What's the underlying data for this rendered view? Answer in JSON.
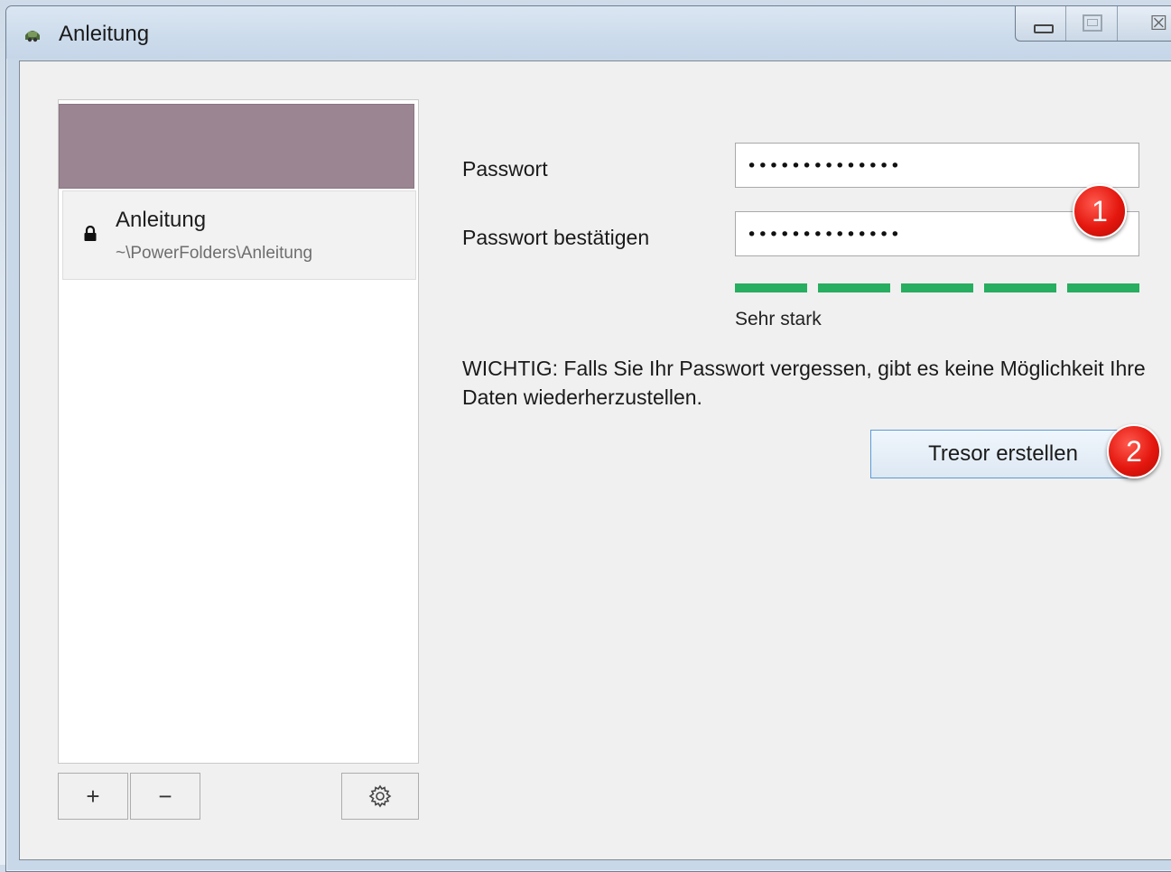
{
  "window": {
    "title": "Anleitung",
    "app_icon": "app-icon",
    "close_glyph": "☒"
  },
  "sidebar": {
    "items": [
      {
        "name": "Anleitung",
        "path": "~\\PowerFolders\\Anleitung",
        "icon": "lock-icon"
      }
    ],
    "add_label": "+",
    "remove_label": "−",
    "settings_icon": "gear-icon"
  },
  "form": {
    "password_label": "Passwort",
    "password_value": "••••••••••••••",
    "confirm_label": "Passwort bestätigen",
    "confirm_value": "••••••••••••••",
    "strength_level": 5,
    "strength_max": 5,
    "strength_text": "Sehr stark",
    "strength_color": "#27ae60",
    "warning_text": "WICHTIG: Falls Sie Ihr Passwort vergessen, gibt es keine Möglichkeit Ihre Daten wiederherzustellen.",
    "create_button": "Tresor erstellen"
  },
  "annotations": {
    "badge_1": "1",
    "badge_2": "2",
    "badge_color": "#e4170e"
  },
  "colors": {
    "list_header": "#9b8592",
    "button_border_focus": "#5b9bd5"
  }
}
